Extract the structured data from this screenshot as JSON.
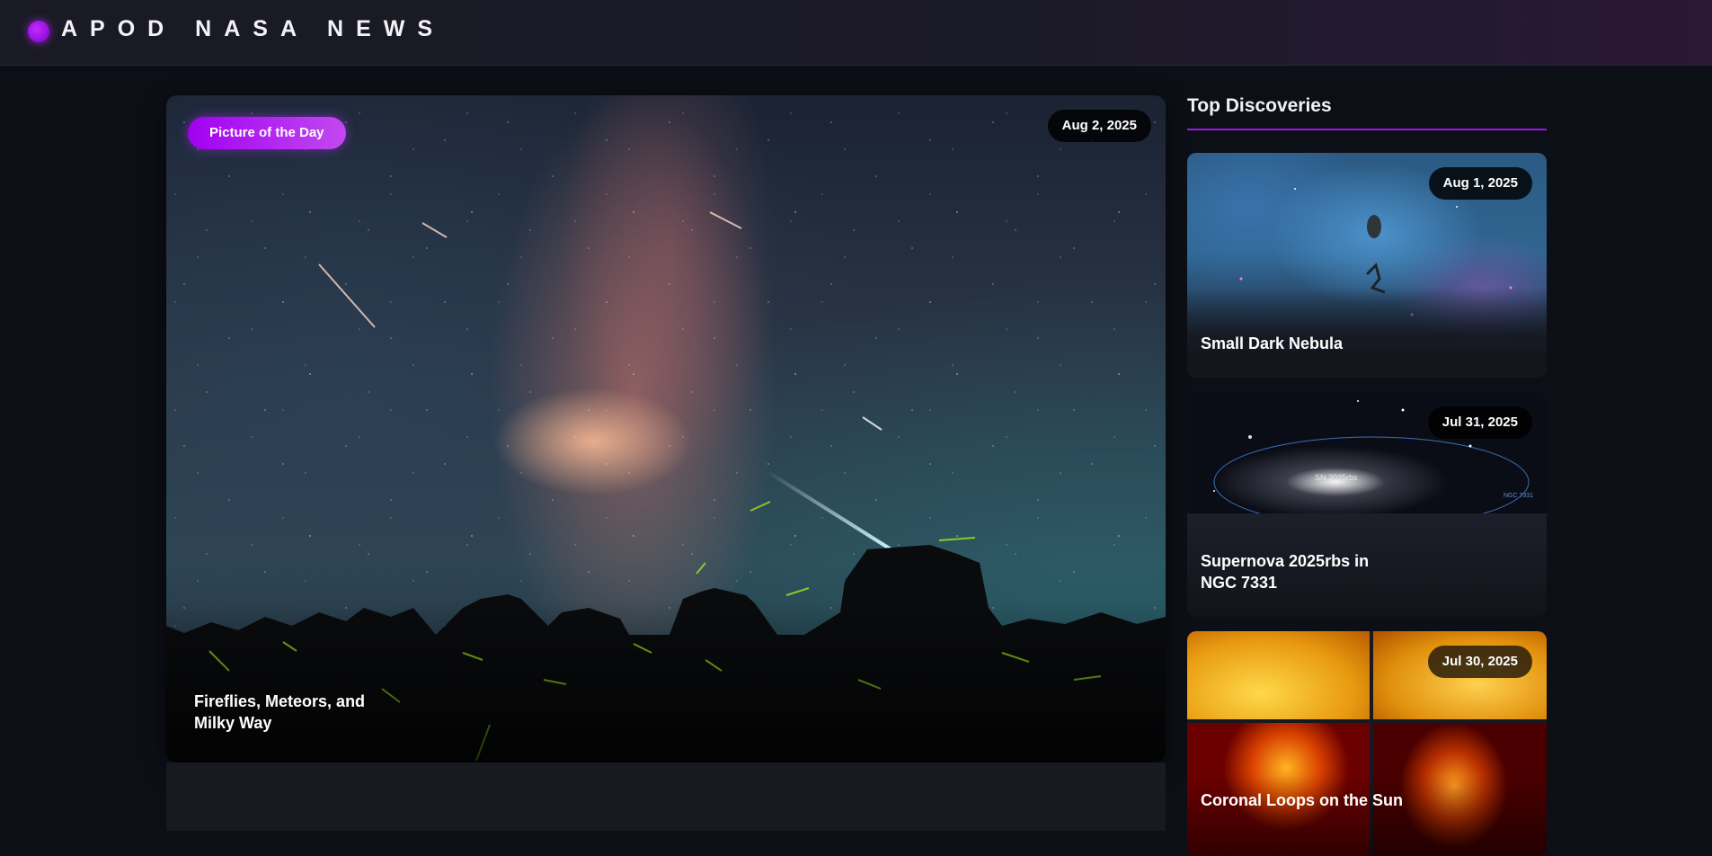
{
  "header": {
    "brand": "APOD NASA NEWS"
  },
  "hero": {
    "badge": "Picture of the Day",
    "date": "Aug 2, 2025",
    "title": "Fireflies, Meteors, and Milky Way"
  },
  "sidebar": {
    "title": "Top Discoveries",
    "cards": [
      {
        "date": "Aug 1, 2025",
        "title": "Small Dark Nebula"
      },
      {
        "date": "Jul 31, 2025",
        "title": "Supernova 2025rbs in NGC 7331",
        "image_label": "SN 2025rbs",
        "image_label_2": "NGC 7331"
      },
      {
        "date": "Jul 30, 2025",
        "title": "Coronal Loops on the Sun"
      }
    ]
  },
  "colors": {
    "accent": "#a100f2",
    "background": "#0d0f17",
    "card": "#161922"
  }
}
